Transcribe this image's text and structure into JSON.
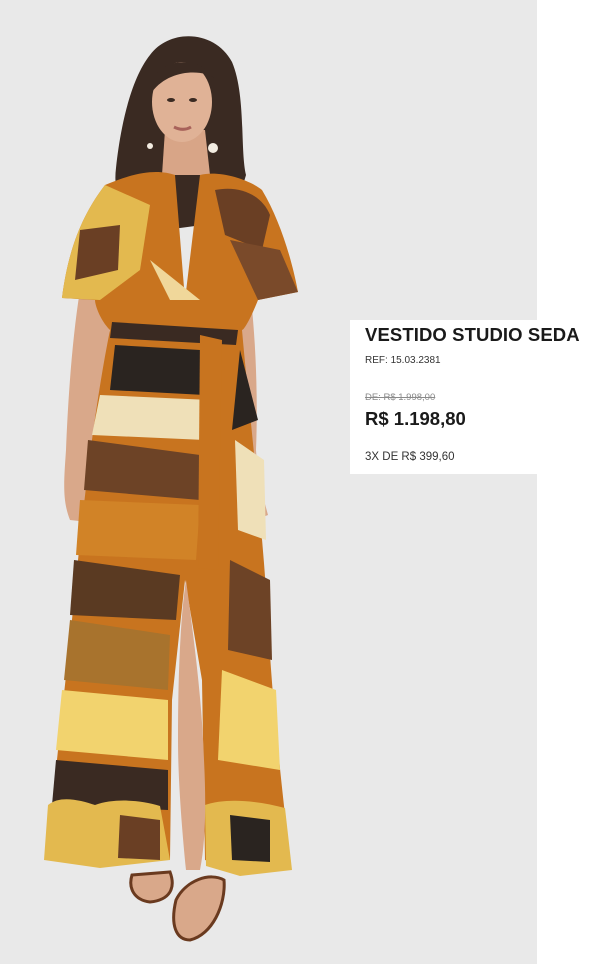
{
  "product": {
    "image_alt": "Model wearing printed silk wrap maxi dress",
    "name": "VESTIDO STUDIO SEDA",
    "ref_label": "REF:",
    "ref_value": "15.03.2381",
    "old_price": "DE: R$ 1.998,00",
    "price": "R$ 1.198,80",
    "installments": "3X DE R$ 399,60"
  },
  "colors": {
    "photo_background": "#e9e9e9",
    "card_background": "#ffffff",
    "text_primary": "#1a1a1a",
    "text_muted": "#8a8a8a"
  }
}
